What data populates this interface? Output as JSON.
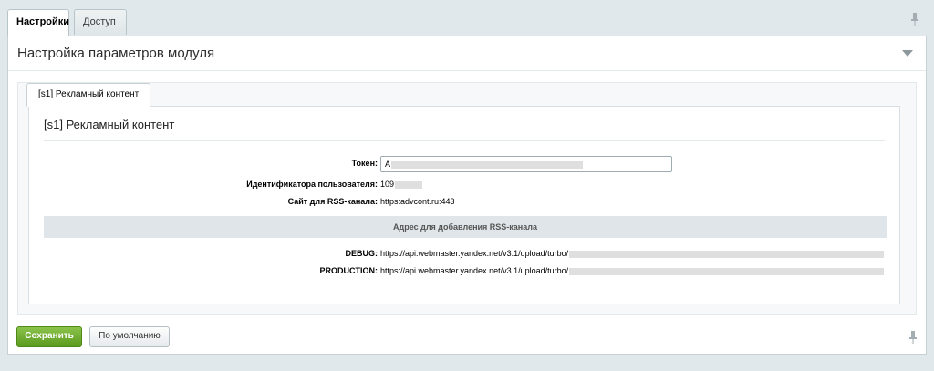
{
  "tabs": [
    {
      "label": "Настройки",
      "active": true
    },
    {
      "label": "Доступ",
      "active": false
    }
  ],
  "panel": {
    "title": "Настройка параметров модуля"
  },
  "subtab": {
    "label": "[s1] Рекламный контент"
  },
  "section": {
    "title": "[s1] Рекламный контент"
  },
  "fields": {
    "token": {
      "label": "Токен:",
      "value": "A"
    },
    "user_id": {
      "label": "Идентификатора пользователя:",
      "value": "109"
    },
    "rss_site": {
      "label": "Сайт для RSS-канала:",
      "value": "https:advcont.ru:443"
    }
  },
  "rss_address": {
    "header": "Адрес для добавления RSS-канала",
    "debug": {
      "label": "DEBUG:",
      "value": "https://api.webmaster.yandex.net/v3.1/upload/turbo/"
    },
    "production": {
      "label": "PRODUCTION:",
      "value": "https://api.webmaster.yandex.net/v3.1/upload/turbo/"
    }
  },
  "buttons": {
    "save": "Сохранить",
    "default": "По умолчанию"
  },
  "colors": {
    "accent_green": "#6cae2a",
    "background": "#e1e8eb"
  }
}
